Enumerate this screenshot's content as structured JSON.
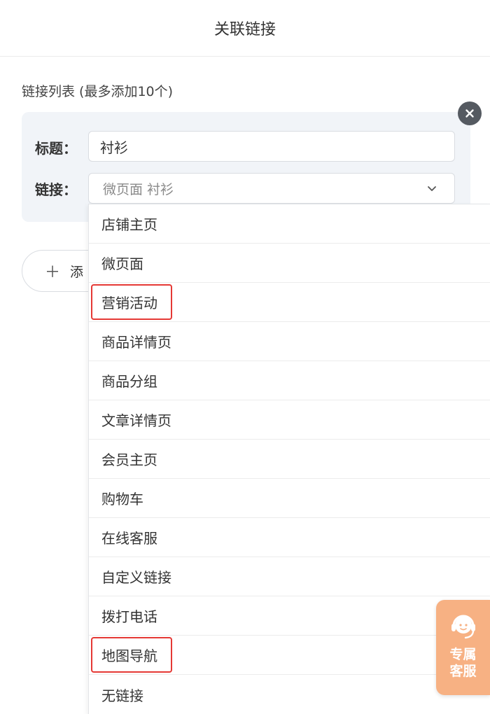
{
  "header": {
    "title": "关联链接"
  },
  "link_list": {
    "title": "链接列表 (最多添加10个)",
    "card": {
      "title_label": "标题：",
      "title_value": "衬衫",
      "link_label": "链接：",
      "link_value": "微页面  衬衫"
    },
    "add_button_label": "添"
  },
  "dropdown": {
    "items": [
      {
        "label": "店铺主页",
        "highlighted": false
      },
      {
        "label": "微页面",
        "highlighted": false
      },
      {
        "label": "营销活动",
        "highlighted": true
      },
      {
        "label": "商品详情页",
        "highlighted": false
      },
      {
        "label": "商品分组",
        "highlighted": false
      },
      {
        "label": "文章详情页",
        "highlighted": false
      },
      {
        "label": "会员主页",
        "highlighted": false
      },
      {
        "label": "购物车",
        "highlighted": false
      },
      {
        "label": "在线客服",
        "highlighted": false
      },
      {
        "label": "自定义链接",
        "highlighted": false
      },
      {
        "label": "拨打电话",
        "highlighted": false
      },
      {
        "label": "地图导航",
        "highlighted": true
      },
      {
        "label": "无链接",
        "highlighted": false
      }
    ]
  },
  "support_widget": {
    "label": "专属客服",
    "icon": "headset-icon"
  },
  "colors": {
    "highlight_border": "#e53935",
    "card_background": "#f1f4f8",
    "support_widget": "#f7b183"
  }
}
